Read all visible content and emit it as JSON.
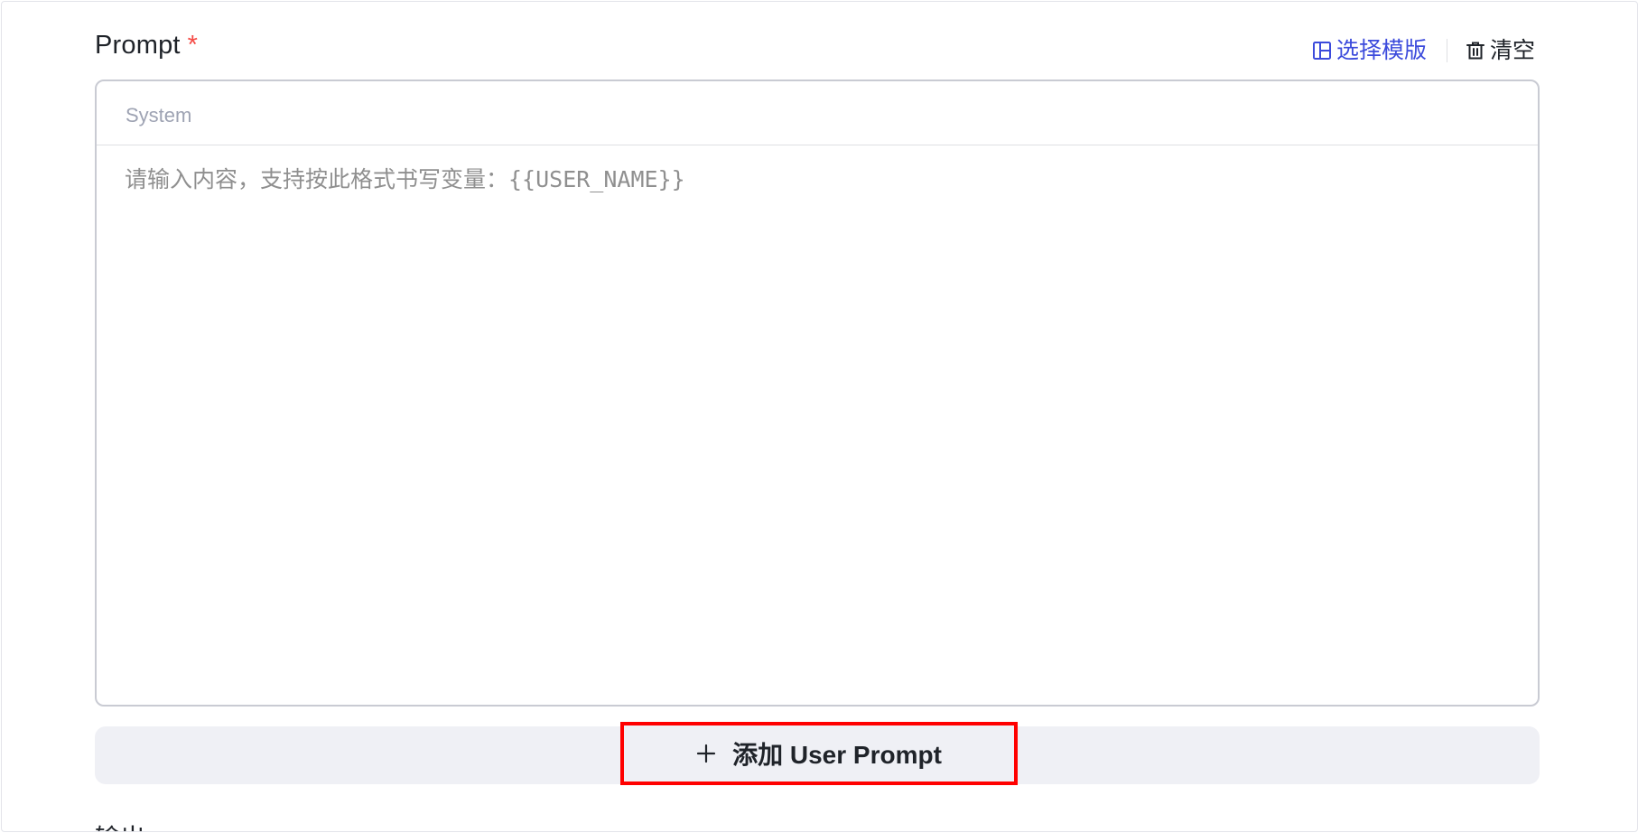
{
  "prompt_section": {
    "title": "Prompt",
    "required_marker": "*",
    "actions": {
      "select_template_label": "选择模版",
      "clear_label": "清空"
    },
    "editor": {
      "role_label": "System",
      "content_value": "",
      "content_placeholder": "请输入内容，支持按此格式书写变量：{{USER_NAME}}"
    },
    "add_user_prompt_label": "添加 User Prompt"
  },
  "next_section": {
    "partial_title": "输出"
  },
  "colors": {
    "accent": "#3c4bdc",
    "required": "#f54a45",
    "highlight_border": "#ff0000",
    "add_bar_bg": "#eff0f5"
  },
  "icons": {
    "template": "layout-template-icon",
    "clear": "trash-icon",
    "add": "plus-icon"
  }
}
